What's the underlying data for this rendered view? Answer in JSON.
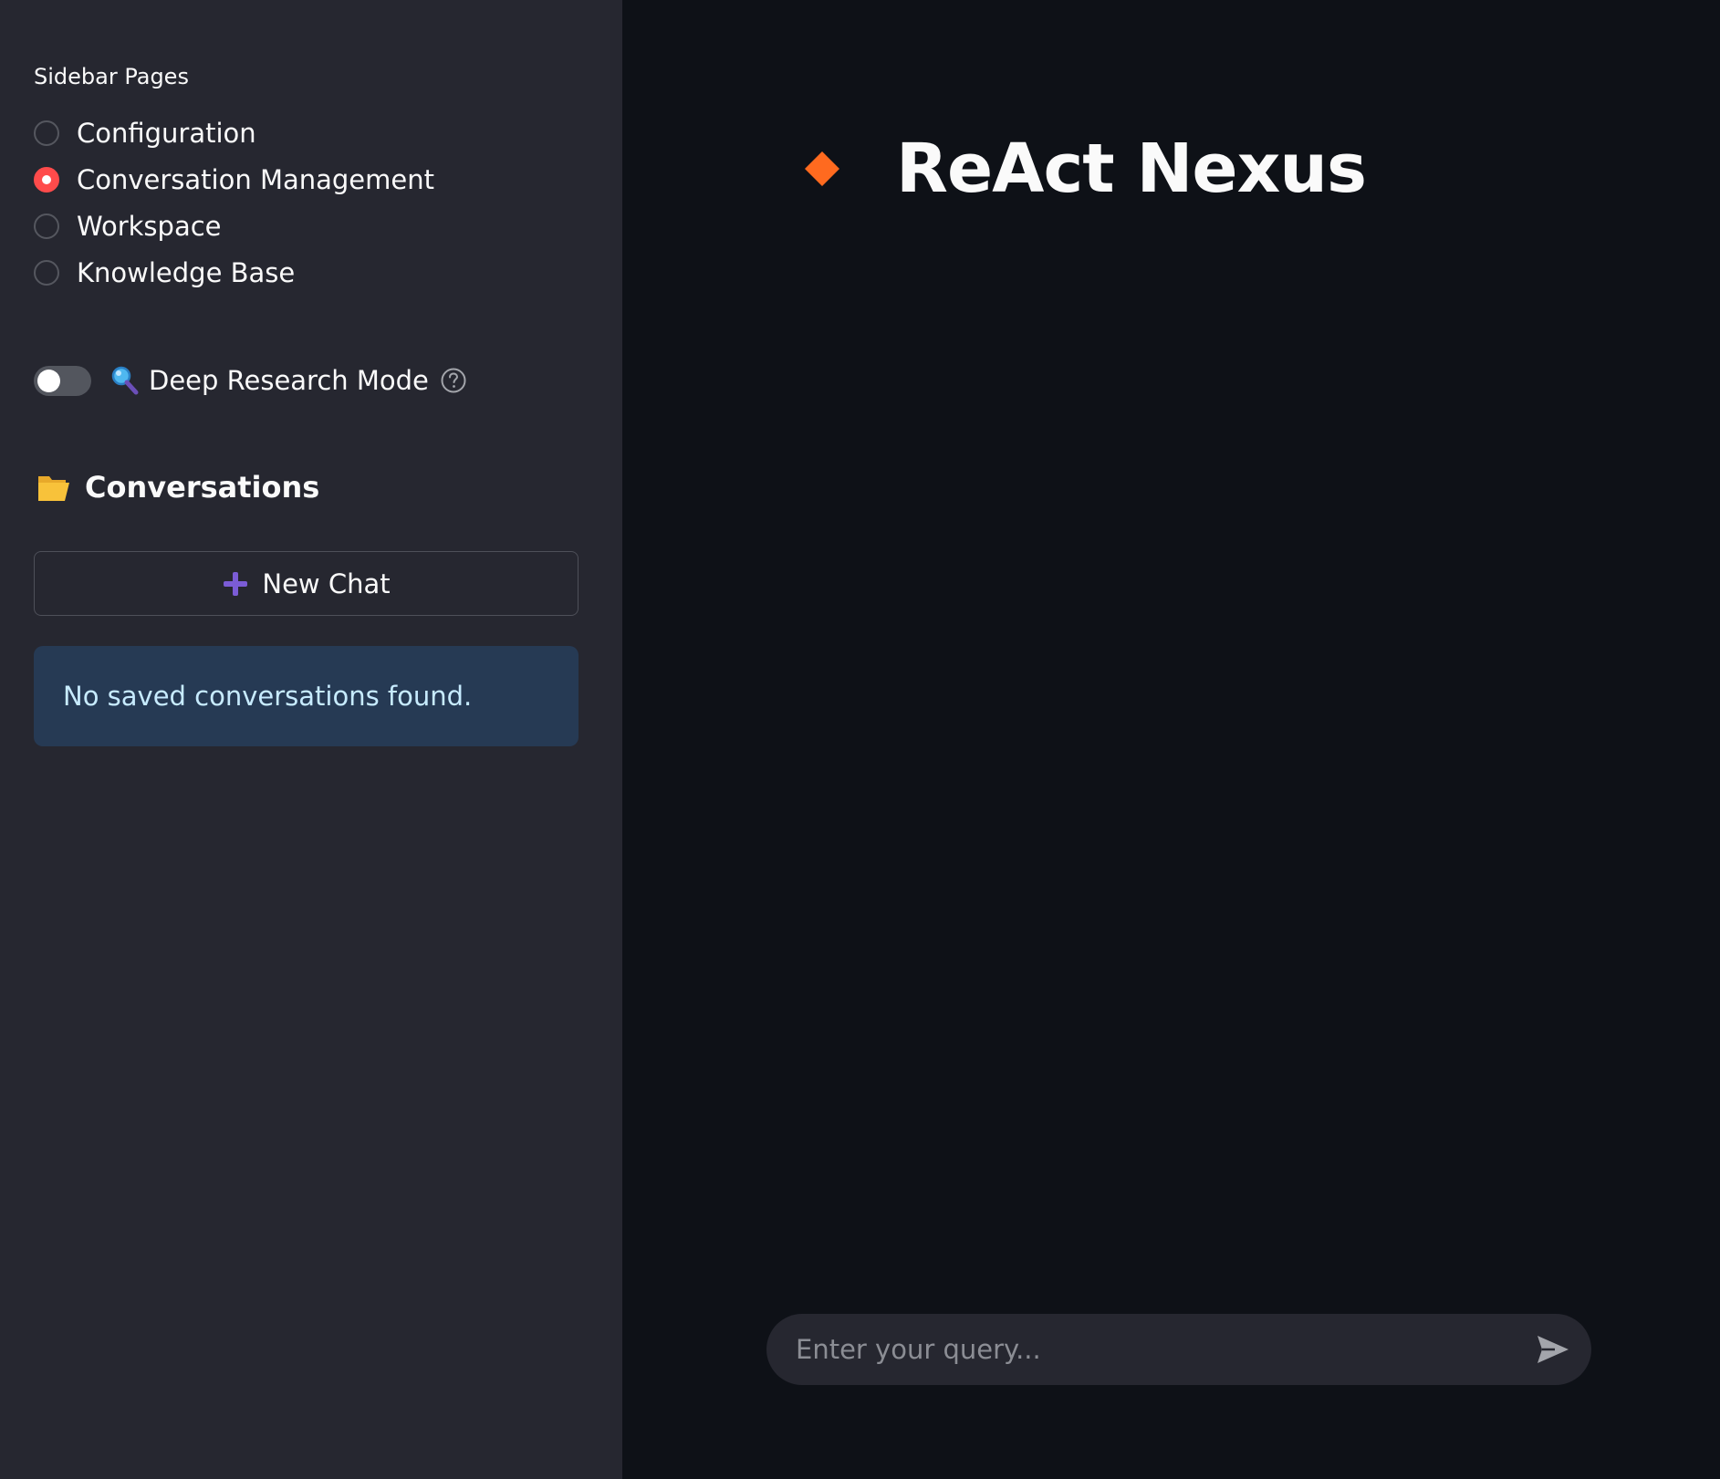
{
  "sidebar": {
    "pages_label": "Sidebar Pages",
    "pages": [
      {
        "label": "Configuration",
        "selected": false
      },
      {
        "label": "Conversation Management",
        "selected": true
      },
      {
        "label": "Workspace",
        "selected": false
      },
      {
        "label": "Knowledge Base",
        "selected": false
      }
    ],
    "deep_research": {
      "label": "Deep Research Mode",
      "enabled": false
    },
    "conversations": {
      "title": "Conversations",
      "new_chat_label": "New Chat",
      "empty_message": "No saved conversations found."
    }
  },
  "main": {
    "title": "ReAct Nexus",
    "chat_input": {
      "placeholder": "Enter your query..."
    }
  },
  "colors": {
    "sidebar_bg": "#262730",
    "main_bg": "#0e1117",
    "accent_red": "#ff4b4b",
    "diamond_orange": "#ff6a1f",
    "info_bg": "#263a54",
    "info_text": "#c7ebff",
    "plus_purple": "#7b5cd6",
    "folder_yellow": "#f8c23a"
  },
  "icons": {
    "title_icon": "orange-diamond-icon",
    "toggle_icon": "magnifying-glass-icon",
    "help_icon": "question-circle-icon",
    "section_icon": "open-folder-icon",
    "new_chat_icon": "plus-icon",
    "send_icon": "send-arrow-icon"
  }
}
